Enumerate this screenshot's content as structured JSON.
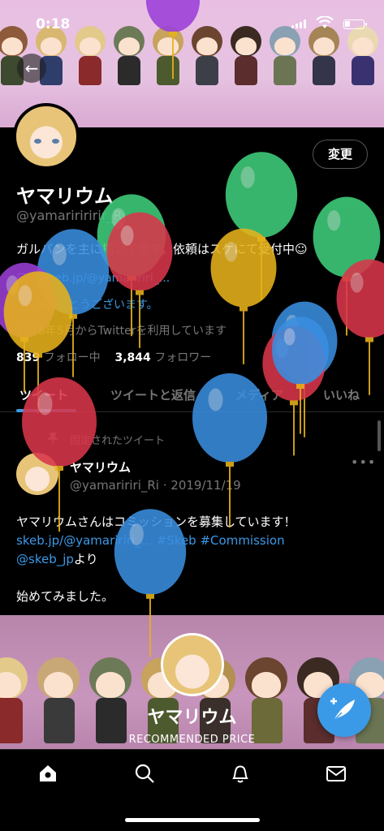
{
  "status_bar": {
    "time": "0:18"
  },
  "profile": {
    "name": "ヤマリウム",
    "handle": "@yamaririririr_Ri",
    "edit_label": "変更",
    "bio": "ガルパンを主に描いてます。依頼はスケにて受付中☺",
    "location": "ワ",
    "website": "skeb.jp/@yamaririri_...",
    "birthday": "おめでとうございます。",
    "joined": "2016年5月からTwitterを利用しています",
    "following_count": "839",
    "following_label": "フォロー中",
    "followers_count": "3,844",
    "followers_label": "フォロワー"
  },
  "tabs": [
    {
      "label": "ツイート"
    },
    {
      "label": "ツイートと返信"
    },
    {
      "label": "メディア"
    },
    {
      "label": "いいね"
    }
  ],
  "pinned_tweet": {
    "pinned_label": "固定されたツイート",
    "author": "ヤマリウム",
    "handle_date": "@yamaririri_Ri · 2019/11/19",
    "line1": "ヤマリウムさんはコミッションを募集しています！",
    "link1": "skeb.jp/@yamaririri_...",
    "tag1": "#Skeb",
    "tag2": "#Commission",
    "mention": "@skeb_jp",
    "yori": "より",
    "line3": "始めてみました。"
  },
  "promo": {
    "name": "ヤマリウム",
    "price_label": "RECOMMENDED PRICE"
  },
  "icons": {
    "back": "arrow-left-icon",
    "compose": "feather-plus-icon",
    "home": "home-icon",
    "search": "search-icon",
    "notifications": "bell-icon",
    "messages": "mail-icon"
  },
  "colors": {
    "accent": "#3a9ae8",
    "background": "#000000",
    "muted_text": "#777777"
  }
}
